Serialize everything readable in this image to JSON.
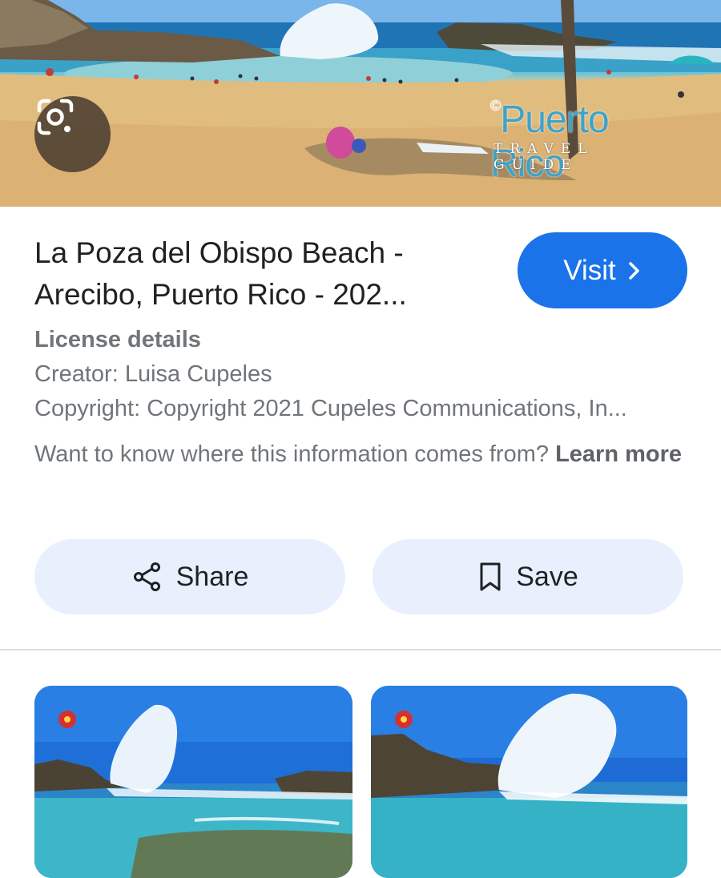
{
  "hero": {
    "lens_icon": "google-lens-icon",
    "watermark_title": "Puerto Rico",
    "watermark_subtitle": "TRAVEL GUIDE",
    "watermark_mark": "©"
  },
  "result": {
    "title_line1": "La Poza del Obispo Beach -",
    "title_line2": "Arecibo, Puerto Rico - 202...",
    "visit_label": "Visit",
    "visit_icon": "chevron-right-icon",
    "license_heading": "License details",
    "creator": "Creator: Luisa Cupeles",
    "copyright": "Copyright: Copyright 2021 Cupeles Communications, In...",
    "source_text": "Want to know where this information comes from? ",
    "learn_more": "Learn more"
  },
  "actions": {
    "share_label": "Share",
    "share_icon": "share-icon",
    "save_label": "Save",
    "save_icon": "bookmark-icon"
  },
  "colors": {
    "accent": "#1a73e8",
    "action_bg": "#e8f0fe",
    "muted_text": "#70757a"
  }
}
